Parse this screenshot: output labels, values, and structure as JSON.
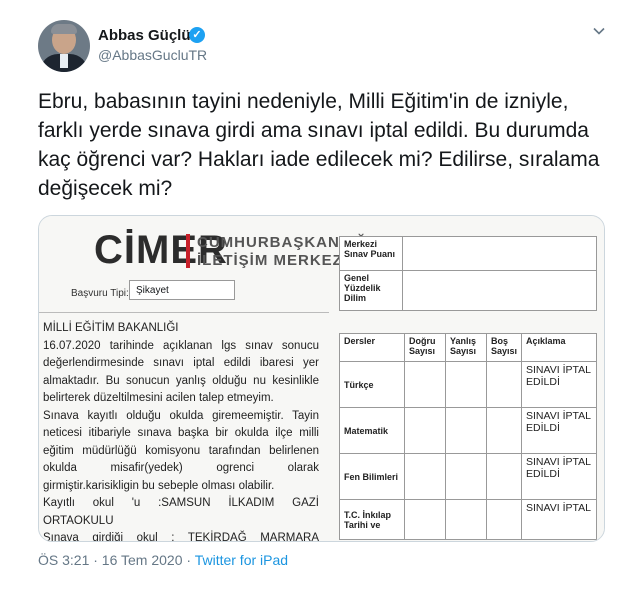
{
  "author": {
    "name": "Abbas Güçlü",
    "handle": "@AbbasGucluTR",
    "verified": "✓"
  },
  "tweet": {
    "text": "Ebru, babasının tayini nedeniyle, Milli Eğitim'in de izniyle, farklı yerde sınava girdi ama sınavı iptal edildi. Bu durumda kaç öğrenci var? Hakları iade edilecek mi? Edilirse, sıralama değişecek mi?",
    "time": "ÖS 3:21 · 16 Tem 2020 · ",
    "source": "Twitter for iPad"
  },
  "document": {
    "logo": "CİMER",
    "logo_line1": "CUMHURBAŞKANLIĞ",
    "logo_line2": "İLETİŞİM MERKEZ",
    "basvuru_label": "Başvuru Tipi:",
    "basvuru_value": "Şikayet",
    "body": [
      "MİLLİ EĞİTİM BAKANLIĞI",
      "16.07.2020 tarihinde açıklanan lgs sınav sonucu değerlendirmesinde sınavı iptal edildi ibaresi yer almaktadır. Bu sonucun yanlış olduğu nu kesinlikle belirterek düzeltilmesini acilen talep etmeyim.",
      "Sınava kayıtlı olduğu okulda giremeemiştir. Tayin neticesi itibariyle sınava başka bir okulda ilçe milli eğitim müdürlüğü komisyonu tarafından belirlenen okulda misafir(yedek) ogrenci olarak girmiştir.karisikligin bu sebeple olması olabilir.",
      "Kayıtlı okul 'u :SAMSUN İLKADIM GAZİ ORTAOKULU",
      "Sınava girdiği okul : TEKİRDAĞ MARMARA EREĞLİSİ."
    ],
    "score_table": [
      {
        "label": "Merkezi Sınav Puanı",
        "value": ""
      },
      {
        "label": "Genel Yüzdelik Dilim",
        "value": ""
      }
    ],
    "results_headers": [
      "Dersler",
      "Doğru Sayısı",
      "Yanlış Sayısı",
      "Boş Sayısı",
      "Açıklama"
    ],
    "results_rows": [
      {
        "subject": "Türkçe",
        "note": "SINAVI İPTAL EDİLDİ"
      },
      {
        "subject": "Matematik",
        "note": "SINAVI İPTAL EDİLDİ"
      },
      {
        "subject": "Fen Bilimleri",
        "note": "SINAVI İPTAL EDİLDİ"
      },
      {
        "subject": "T.C. İnkılap Tarihi ve",
        "note": "SINAVI İPTAL"
      }
    ]
  }
}
